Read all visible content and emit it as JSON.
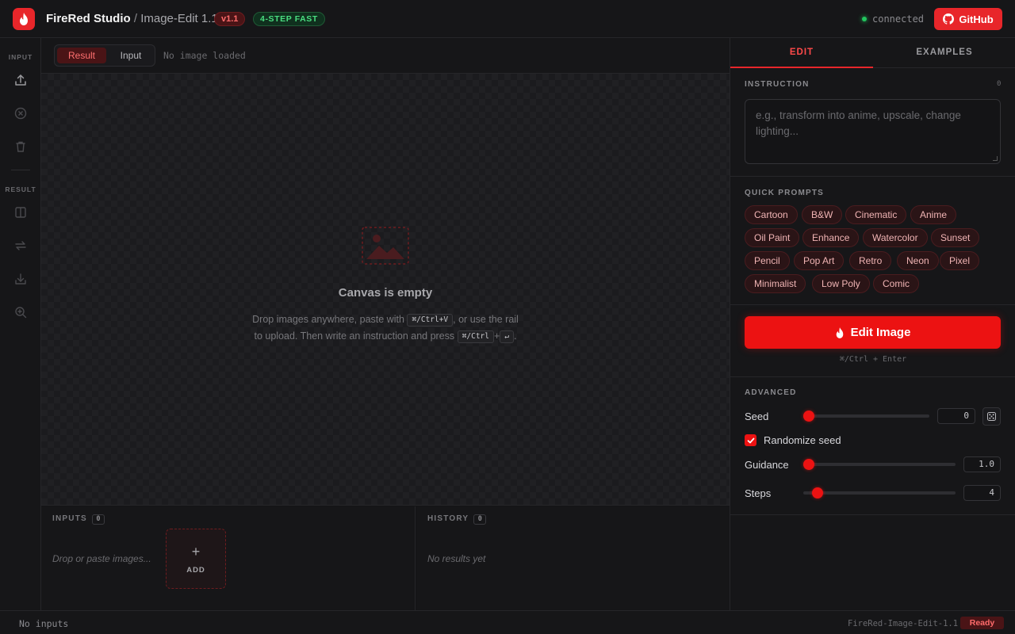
{
  "header": {
    "brand": "FireRed Studio",
    "separator": " / ",
    "product": "Image-Edit 1.1",
    "version_badge": "v1.1",
    "fast_badge": "4-STEP FAST",
    "connection_status": "connected",
    "github_label": "GitHub"
  },
  "rail": {
    "input_label": "INPUT",
    "result_label": "RESULT"
  },
  "canvas": {
    "toggle_result": "Result",
    "toggle_input": "Input",
    "status": "No image loaded",
    "empty_title": "Canvas is empty",
    "empty_desc_1": "Drop images anywhere, paste with",
    "kbd_paste": "⌘/Ctrl+V",
    "empty_desc_2": ", or use the rail to upload. Then write an instruction and press",
    "kbd_mod": "⌘/Ctrl",
    "kbd_plus": "+",
    "kbd_enter": "↵",
    "empty_desc_end": "."
  },
  "inputs_panel": {
    "label": "INPUTS",
    "count": "0",
    "drop_hint": "Drop or paste images...",
    "add_plus": "+",
    "add_label": "ADD"
  },
  "history_panel": {
    "label": "HISTORY",
    "count": "0",
    "empty_text": "No results yet"
  },
  "statusbar": {
    "left": "No inputs",
    "model": "FireRed-Image-Edit-1.1",
    "state": "Ready"
  },
  "right_panel": {
    "tabs": [
      "EDIT",
      "EXAMPLES"
    ],
    "instruction_label": "INSTRUCTION",
    "instruction_count": "0",
    "instruction_placeholder": "e.g., transform into anime, upscale, change lighting...",
    "quick_prompts_label": "QUICK PROMPTS",
    "quick_prompts": [
      "Cartoon",
      "B&W",
      "Cinematic",
      "Anime",
      "Oil Paint",
      "Enhance",
      "Watercolor",
      "Sunset",
      "Pencil",
      "Pop Art",
      "Retro",
      "Neon",
      "Pixel",
      "Minimalist",
      "Low Poly",
      "Comic"
    ],
    "edit_button": "Edit Image",
    "edit_hint": "⌘/Ctrl + Enter",
    "advanced_label": "ADVANCED",
    "seed_label": "Seed",
    "seed_value": "0",
    "randomize_label": "Randomize seed",
    "randomize_checked": true,
    "guidance_label": "Guidance",
    "guidance_value": "1.0",
    "steps_label": "Steps",
    "steps_value": "4"
  },
  "colors": {
    "accent": "#ec1212",
    "connected": "#22c55e",
    "fast_badge": "#4ade80"
  }
}
